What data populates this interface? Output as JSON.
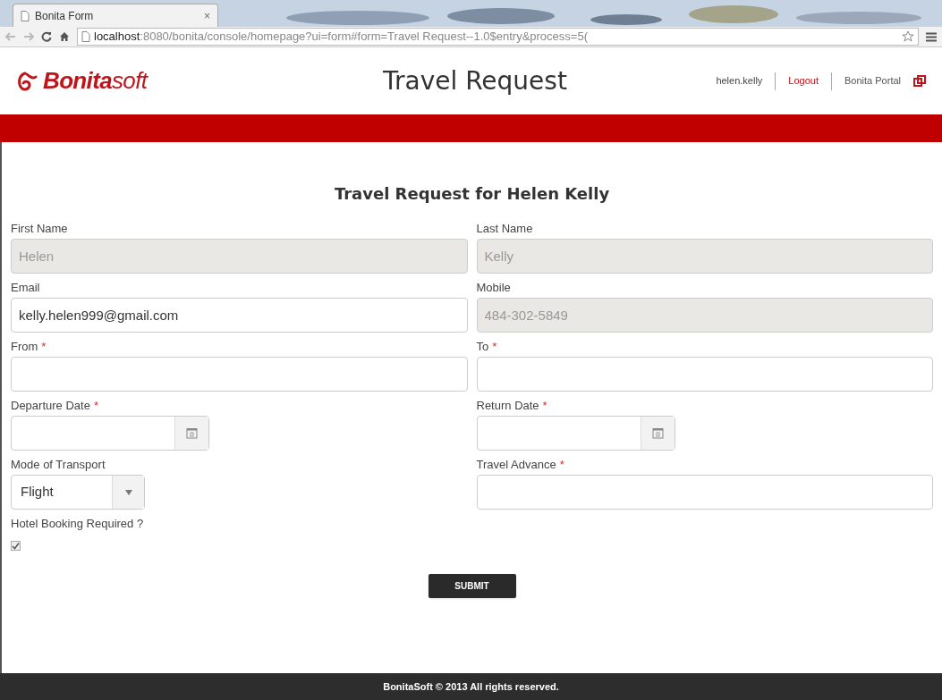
{
  "browser": {
    "tab_title": "Bonita Form",
    "tab_close": "×",
    "url_host": "localhost",
    "url_rest": ":8080/bonita/console/homepage?ui=form#form=Travel Request--1.0$entry&process=5("
  },
  "header": {
    "logo": "**Bonita**soft",
    "title": "Travel Request",
    "user": "helen.kelly",
    "logout": "Logout",
    "portal": "Bonita Portal"
  },
  "form": {
    "heading": "Travel Request for Helen Kelly",
    "rows": [
      [
        {
          "kind": "text",
          "label": "First Name",
          "value": "Helen",
          "disabled": true
        },
        {
          "kind": "text",
          "label": "Last Name",
          "value": "Kelly",
          "disabled": true
        }
      ],
      [
        {
          "kind": "text",
          "label": "Email",
          "value": "kelly.helen999@gmail.com",
          "disabled": false
        },
        {
          "kind": "text",
          "label": "Mobile",
          "value": "484-302-5849",
          "disabled": true
        }
      ],
      [
        {
          "kind": "text",
          "label": "From",
          "required_mark": "*",
          "disabled": false
        },
        {
          "kind": "text",
          "label": "To",
          "required_mark": "*",
          "disabled": false
        }
      ],
      [
        {
          "kind": "date",
          "label": "Departure Date",
          "required_mark": "*"
        },
        {
          "kind": "date",
          "label": "Return Date",
          "required_mark": "*"
        }
      ],
      [
        {
          "kind": "select",
          "label": "Mode of Transport",
          "value": "Flight"
        },
        {
          "kind": "text",
          "label": "Travel Advance",
          "required_mark": "*",
          "disabled": false
        }
      ],
      [
        {
          "kind": "checkbox",
          "label": "Hotel Booking Required ?",
          "checked": true
        }
      ]
    ],
    "submit": "SUBMIT"
  },
  "footer": "BonitaSoft © 2013 All rights reserved."
}
